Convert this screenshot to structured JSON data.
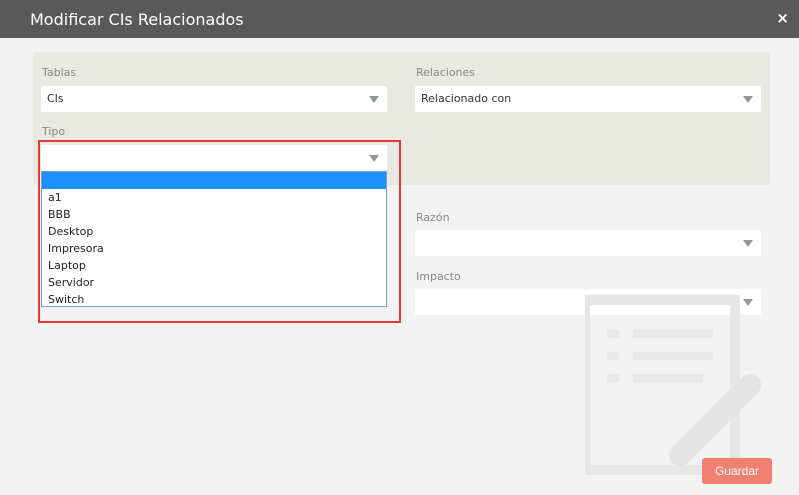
{
  "dialog": {
    "title": "Modificar CIs Relacionados",
    "close_symbol": "×"
  },
  "form": {
    "tablas": {
      "label": "Tablas",
      "value": "CIs"
    },
    "relaciones": {
      "label": "Relaciones",
      "value": "Relacionado con"
    },
    "tipo": {
      "label": "Tipo",
      "value": ""
    },
    "razon": {
      "label": "Razón",
      "value": ""
    },
    "impacto": {
      "label": "Impacto",
      "value": ""
    }
  },
  "tipo_dropdown": {
    "options": [
      "",
      "a1",
      "BBB",
      "Desktop",
      "Impresora",
      "Laptop",
      "Servidor",
      "Switch"
    ],
    "selected_index": 0
  },
  "footer": {
    "save_label": "Guardar"
  },
  "colors": {
    "header_bg": "#595959",
    "panel_bg": "#e9e9e3",
    "accent": "#f08070",
    "highlight": "#e53935",
    "selection": "#1e90ff"
  },
  "icons": {
    "close": "close-icon",
    "arrow": "chevron-down-icon",
    "watermark": "document-edit-icon"
  }
}
